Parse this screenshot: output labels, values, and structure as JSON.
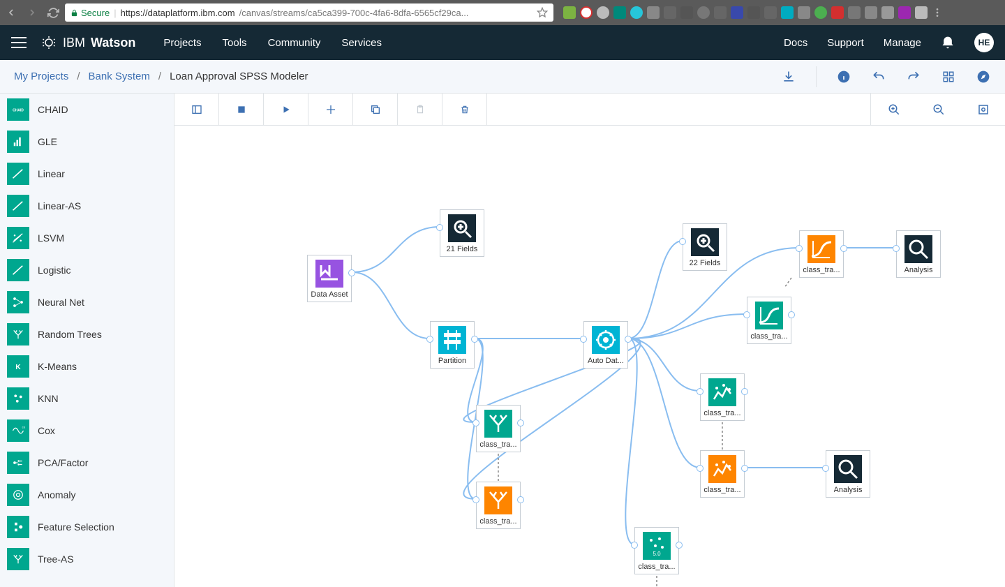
{
  "chrome": {
    "secure_label": "Secure",
    "url_host": "https://dataplatform.ibm.com",
    "url_path": "/canvas/streams/ca5ca399-700c-4fa6-8dfa-6565cf29ca..."
  },
  "header": {
    "brand_thin": "IBM",
    "brand_bold": "Watson",
    "nav": {
      "projects": "Projects",
      "tools": "Tools",
      "community": "Community",
      "services": "Services"
    },
    "right": {
      "docs": "Docs",
      "support": "Support",
      "manage": "Manage"
    },
    "avatar_initials": "HE"
  },
  "breadcrumb": {
    "root": "My Projects",
    "project": "Bank System",
    "current": "Loan Approval SPSS Modeler"
  },
  "sidebar": {
    "items": [
      {
        "label": "CHAID",
        "icon": "chaid"
      },
      {
        "label": "GLE",
        "icon": "gle"
      },
      {
        "label": "Linear",
        "icon": "linear"
      },
      {
        "label": "Linear-AS",
        "icon": "linear"
      },
      {
        "label": "LSVM",
        "icon": "lsvm"
      },
      {
        "label": "Logistic",
        "icon": "linear"
      },
      {
        "label": "Neural Net",
        "icon": "neural"
      },
      {
        "label": "Random Trees",
        "icon": "trees"
      },
      {
        "label": "K-Means",
        "icon": "kmeans"
      },
      {
        "label": "KNN",
        "icon": "knn"
      },
      {
        "label": "Cox",
        "icon": "cox"
      },
      {
        "label": "PCA/Factor",
        "icon": "pca"
      },
      {
        "label": "Anomaly",
        "icon": "anomaly"
      },
      {
        "label": "Feature Selection",
        "icon": "feature"
      },
      {
        "label": "Tree-AS",
        "icon": "trees"
      }
    ]
  },
  "canvas": {
    "nodes": {
      "data_asset": {
        "label": "Data Asset"
      },
      "fields21": {
        "label": "21 Fields"
      },
      "partition": {
        "label": "Partition"
      },
      "autodat": {
        "label": "Auto Dat..."
      },
      "fields22": {
        "label": "22 Fields"
      },
      "classtra_o1": {
        "label": "class_tra..."
      },
      "analysis1": {
        "label": "Analysis"
      },
      "classtra_t1": {
        "label": "class_tra..."
      },
      "classtra_t2": {
        "label": "class_tra..."
      },
      "classtra_o2": {
        "label": "class_tra..."
      },
      "analysis2": {
        "label": "Analysis"
      },
      "classtra_t3": {
        "label": "class_tra..."
      },
      "classtra_o3": {
        "label": "class_tra..."
      },
      "classtra_c50": {
        "label": "class_tra..."
      }
    }
  }
}
